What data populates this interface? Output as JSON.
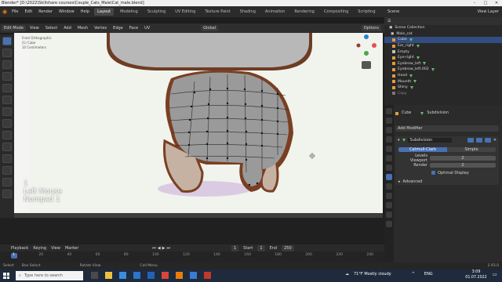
{
  "window": {
    "title": "Blender* [D:\\2022\\Skillshare courses\\Couple_Cats_Male\\Cat_male.blend]"
  },
  "menu": {
    "items": [
      "File",
      "Edit",
      "Render",
      "Window",
      "Help"
    ],
    "workspaces": [
      "Layout",
      "Modeling",
      "Sculpting",
      "UV Editing",
      "Texture Paint",
      "Shading",
      "Animation",
      "Rendering",
      "Compositing",
      "Scripting"
    ],
    "active_workspace": "Layout",
    "scene": "Scene",
    "view_layer": "View Layer"
  },
  "viewport_header": {
    "mode": "Edit Mode",
    "items": [
      "View",
      "Select",
      "Add",
      "Mesh",
      "Vertex",
      "Edge",
      "Face",
      "UV"
    ],
    "orientation": "Global",
    "options": "Options"
  },
  "viewport": {
    "overlay_info": [
      "Front Orthographic",
      "(1) Cube",
      "10 Centimeters"
    ],
    "keys_overlay": [
      "1",
      "Left Mouse",
      "Numpad 1"
    ]
  },
  "outliner": {
    "collection": "Scene Collection",
    "items": [
      {
        "name": "Male_cat",
        "type": "collection",
        "selected": false
      },
      {
        "name": "Cube",
        "type": "mesh",
        "selected": true
      },
      {
        "name": "Ear_right",
        "type": "mesh",
        "selected": false
      },
      {
        "name": "Empty",
        "type": "empty",
        "selected": false
      },
      {
        "name": "Eye-right",
        "type": "mesh",
        "selected": false
      },
      {
        "name": "Eyebrow_left",
        "type": "mesh",
        "selected": false
      },
      {
        "name": "Eyebrow_left.002",
        "type": "mesh",
        "selected": false
      },
      {
        "name": "Head",
        "type": "mesh",
        "selected": false
      },
      {
        "name": "Mounth",
        "type": "mesh",
        "selected": false
      },
      {
        "name": "Shiny",
        "type": "mesh",
        "selected": false
      },
      {
        "name": "Copy",
        "type": "mesh",
        "selected": false
      }
    ]
  },
  "properties": {
    "object": "Cube",
    "modifier_type_label": "Subdivision",
    "add_modifier": "Add Modifier",
    "modifier_name": "Subdivision",
    "methods": [
      "Catmull-Clark",
      "Simple"
    ],
    "active_method": "Catmull-Clark",
    "levels_viewport_label": "Levels Viewport",
    "levels_viewport": "2",
    "render_label": "Render",
    "render": "2",
    "optimal_display": "Optimal Display",
    "advanced": "Advanced"
  },
  "timeline": {
    "menus": [
      "Playback",
      "Keying",
      "View",
      "Marker"
    ],
    "current_frame": "1",
    "start_label": "Start",
    "start": "1",
    "end_label": "End",
    "end": "250",
    "ticks": [
      "1",
      "20",
      "40",
      "60",
      "80",
      "100",
      "120",
      "140",
      "160",
      "180",
      "200",
      "220",
      "240"
    ]
  },
  "status": {
    "items": [
      "Select",
      "Box Select",
      "Rotate View",
      "Call Menu"
    ],
    "version": "2.93.0"
  },
  "taskbar": {
    "search_placeholder": "Type here to search",
    "weather": "71°F  Mostly cloudy",
    "lang": "ENG",
    "time": "3:09",
    "date": "01.07.2022"
  },
  "colors": {
    "accent": "#4772b3",
    "selection": "#334d80",
    "viewport_bg": "#f1f3ed",
    "mesh_gray": "#9b9b9b",
    "outline_orange": "#8a4a2b"
  }
}
